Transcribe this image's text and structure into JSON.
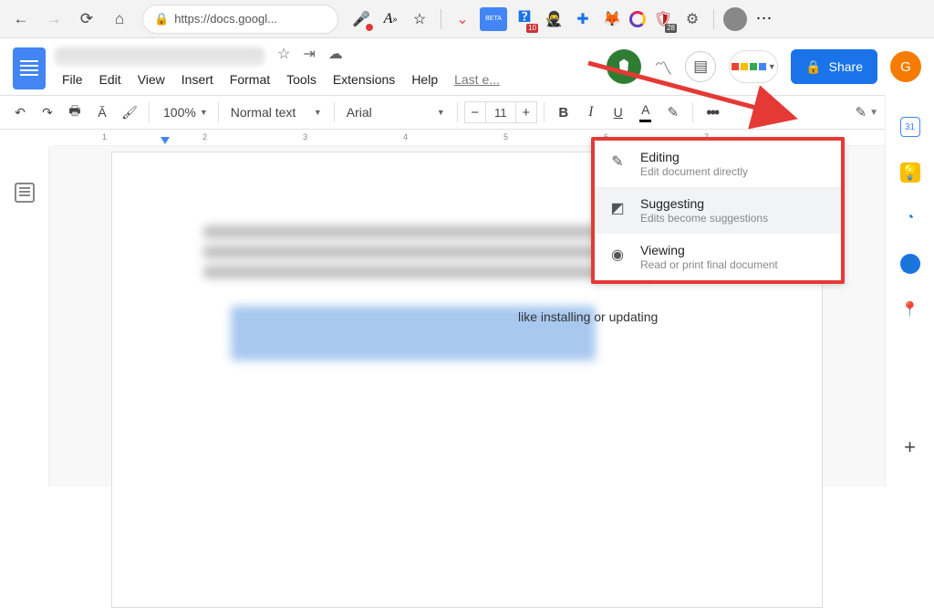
{
  "browser": {
    "url": "https://docs.googl...",
    "pocket_badge": "BETA",
    "tp_badge": "10",
    "shield_badge": "28"
  },
  "menus": {
    "file": "File",
    "edit": "Edit",
    "view": "View",
    "insert": "Insert",
    "format": "Format",
    "tools": "Tools",
    "extensions": "Extensions",
    "help": "Help",
    "last_edit": "Last e..."
  },
  "header": {
    "share": "Share",
    "account_initial": "G"
  },
  "toolbar": {
    "zoom": "100%",
    "style": "Normal text",
    "font": "Arial",
    "size": "11",
    "bold": "B",
    "italic": "I",
    "underline": "U",
    "textcolor": "A",
    "more": "•••"
  },
  "ruler": {
    "marks": [
      "1",
      "2",
      "3",
      "4",
      "5",
      "6",
      "7"
    ]
  },
  "leak_text": "like installing or updating",
  "mode_menu": {
    "editing": {
      "title": "Editing",
      "desc": "Edit document directly"
    },
    "suggesting": {
      "title": "Suggesting",
      "desc": "Edits become suggestions"
    },
    "viewing": {
      "title": "Viewing",
      "desc": "Read or print final document"
    }
  },
  "side": {
    "plus": "+"
  }
}
